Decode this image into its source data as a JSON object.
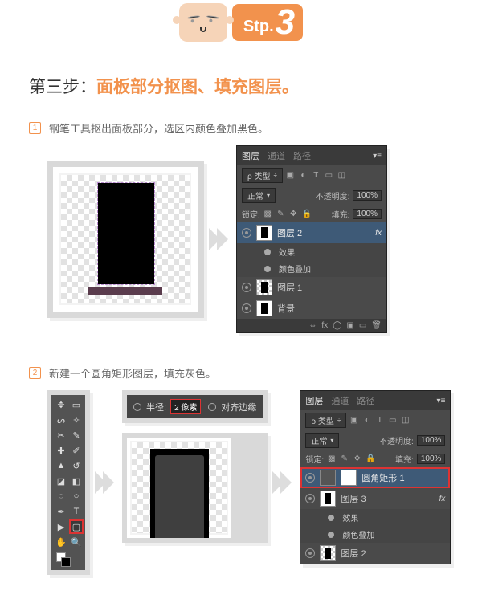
{
  "banner": {
    "prefix": "Stp.",
    "num": "3"
  },
  "heading": {
    "black": "第三步：",
    "orange": "面板部分抠图、填充图层。"
  },
  "substeps": {
    "s1": {
      "num": "1",
      "text": "钢笔工具抠出面板部分，选区内颜色叠加黑色。"
    },
    "s2": {
      "num": "2",
      "text": "新建一个圆角矩形图层，填充灰色。"
    }
  },
  "layersPanel": {
    "tabs": {
      "active": "图层",
      "t2": "通道",
      "t3": "路径"
    },
    "kindLabel": "ρ 类型",
    "blendMode": "正常",
    "opacityLabel": "不透明度:",
    "opacityValue": "100%",
    "lockLabel": "锁定:",
    "fillLabel": "填充:",
    "fillValue": "100%",
    "panel1": {
      "layerSel": "图层 2",
      "fxLabel": "fx",
      "effects": "效果",
      "colorOverlay": "颜色叠加",
      "layer1": "图层 1",
      "bg": "背景"
    },
    "panel2": {
      "roundedRect": "圆角矩形 1",
      "layer3": "图层 3",
      "effects": "效果",
      "colorOverlay": "颜色叠加",
      "layer2": "图层 2"
    }
  },
  "optionsBar": {
    "radiusLabel": "半径:",
    "radiusValue": "2 像素",
    "antialias": "对齐边缘"
  }
}
